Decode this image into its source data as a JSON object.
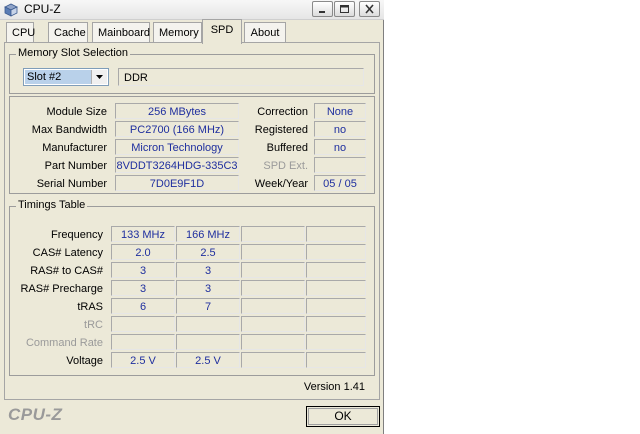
{
  "window": {
    "title": "CPU-Z",
    "icon": "cpu-z-app-icon",
    "controls": [
      "minimize-icon",
      "maximize-icon",
      "close-icon"
    ]
  },
  "tabs": [
    {
      "label": "CPU",
      "active": false
    },
    {
      "label": "Cache",
      "active": false
    },
    {
      "label": "Mainboard",
      "active": false
    },
    {
      "label": "Memory",
      "active": false
    },
    {
      "label": "SPD",
      "active": true
    },
    {
      "label": "About",
      "active": false
    }
  ],
  "slot_selection": {
    "title": "Memory Slot Selection",
    "selected_slot": "Slot #2",
    "memory_type": "DDR"
  },
  "module_info": {
    "left": [
      {
        "label": "Module Size",
        "value": "256 MBytes"
      },
      {
        "label": "Max Bandwidth",
        "value": "PC2700 (166 MHz)"
      },
      {
        "label": "Manufacturer",
        "value": "Micron Technology"
      },
      {
        "label": "Part Number",
        "value": "8VDDT3264HDG-335C3"
      },
      {
        "label": "Serial Number",
        "value": "7D0E9F1D"
      }
    ],
    "right": [
      {
        "label": "Correction",
        "value": "None"
      },
      {
        "label": "Registered",
        "value": "no"
      },
      {
        "label": "Buffered",
        "value": "no"
      },
      {
        "label": "SPD Ext.",
        "value": ""
      },
      {
        "label": "Week/Year",
        "value": "05 / 05"
      }
    ]
  },
  "timings": {
    "title": "Timings Table",
    "rows": [
      {
        "label": "Frequency",
        "values": [
          "133 MHz",
          "166 MHz",
          "",
          ""
        ]
      },
      {
        "label": "CAS# Latency",
        "values": [
          "2.0",
          "2.5",
          "",
          ""
        ]
      },
      {
        "label": "RAS# to CAS#",
        "values": [
          "3",
          "3",
          "",
          ""
        ]
      },
      {
        "label": "RAS# Precharge",
        "values": [
          "3",
          "3",
          "",
          ""
        ]
      },
      {
        "label": "tRAS",
        "values": [
          "6",
          "7",
          "",
          ""
        ]
      },
      {
        "label": "tRC",
        "values": [
          "",
          "",
          "",
          ""
        ]
      },
      {
        "label": "Command Rate",
        "values": [
          "",
          "",
          "",
          ""
        ]
      },
      {
        "label": "Voltage",
        "values": [
          "2.5 V",
          "2.5 V",
          "",
          ""
        ]
      }
    ]
  },
  "footer": {
    "version": "Version 1.41",
    "brand": "CPU-Z",
    "ok_label": "OK"
  },
  "colors": {
    "value_text": "#1f2f9f",
    "window_bg": "#ece9d8",
    "dim_label": "#9a9a9a"
  }
}
